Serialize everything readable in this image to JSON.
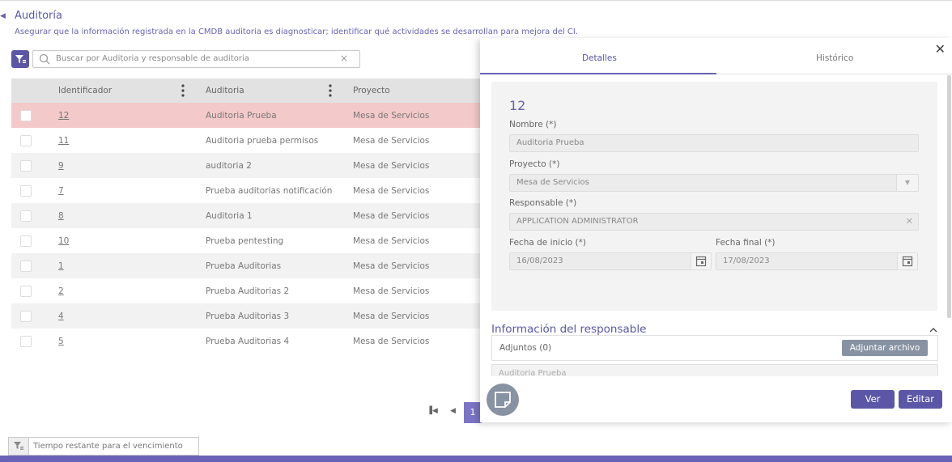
{
  "page": {
    "title": "Auditoría",
    "description": "Asegurar que la información registrada en la CMDB auditoria es diagnosticar; identificar qué actividades se desarrollan para mejora del CI."
  },
  "search": {
    "placeholder": "Buscar por Auditoria y responsable de auditoria",
    "clear": "×"
  },
  "grid": {
    "columns": [
      "Identificador",
      "Auditoria",
      "Proyecto"
    ],
    "rows": [
      {
        "id": "12",
        "auditoria": "Auditoria Prueba",
        "proyecto": "Mesa de Servicios"
      },
      {
        "id": "11",
        "auditoria": "Auditoria prueba permisos",
        "proyecto": "Mesa de Servicios"
      },
      {
        "id": "9",
        "auditoria": "auditoria 2",
        "proyecto": "Mesa de Servicios"
      },
      {
        "id": "7",
        "auditoria": "Prueba auditorias notificación",
        "proyecto": "Mesa de Servicios"
      },
      {
        "id": "8",
        "auditoria": "Auditoria 1",
        "proyecto": "Mesa de Servicios"
      },
      {
        "id": "10",
        "auditoria": "Prueba pentesting",
        "proyecto": "Mesa de Servicios"
      },
      {
        "id": "1",
        "auditoria": "Prueba Auditorias",
        "proyecto": "Mesa de Servicios"
      },
      {
        "id": "2",
        "auditoria": "Prueba Auditorias 2",
        "proyecto": "Mesa de Servicios"
      },
      {
        "id": "4",
        "auditoria": "Prueba Auditorias 3",
        "proyecto": "Mesa de Servicios"
      },
      {
        "id": "5",
        "auditoria": "Prueba Auditorias 4",
        "proyecto": "Mesa de Servicios"
      }
    ]
  },
  "pager": {
    "current": "1"
  },
  "bottom_filter": {
    "label": "Tiempo restante para el vencimiento"
  },
  "detail": {
    "tabs": [
      "Detalles",
      "Histórico"
    ],
    "record_id": "12",
    "fields": {
      "nombre": {
        "label": "Nombre (*)",
        "value": "Auditoria Prueba"
      },
      "proyecto": {
        "label": "Proyecto (*)",
        "value": "Mesa de Servicios"
      },
      "responsable": {
        "label": "Responsable (*)",
        "value": "APPLICATION ADMINISTRATOR"
      },
      "fecha_inicio": {
        "label": "Fecha de inicio (*)",
        "value": "16/08/2023"
      },
      "fecha_final": {
        "label": "Fecha final (*)",
        "value": "17/08/2023"
      }
    },
    "section_title": "Información del responsable",
    "attachments_label": "Adjuntos (0)",
    "attach_button": "Adjuntar archivo",
    "cut_field_value": "Auditoria Prueba",
    "ver_button": "Ver",
    "edit_button": "Editar"
  },
  "colors": {
    "accent": "#5b57a6",
    "selected_row": "#f4c9c9",
    "footer_bar": "#6a63b5"
  }
}
